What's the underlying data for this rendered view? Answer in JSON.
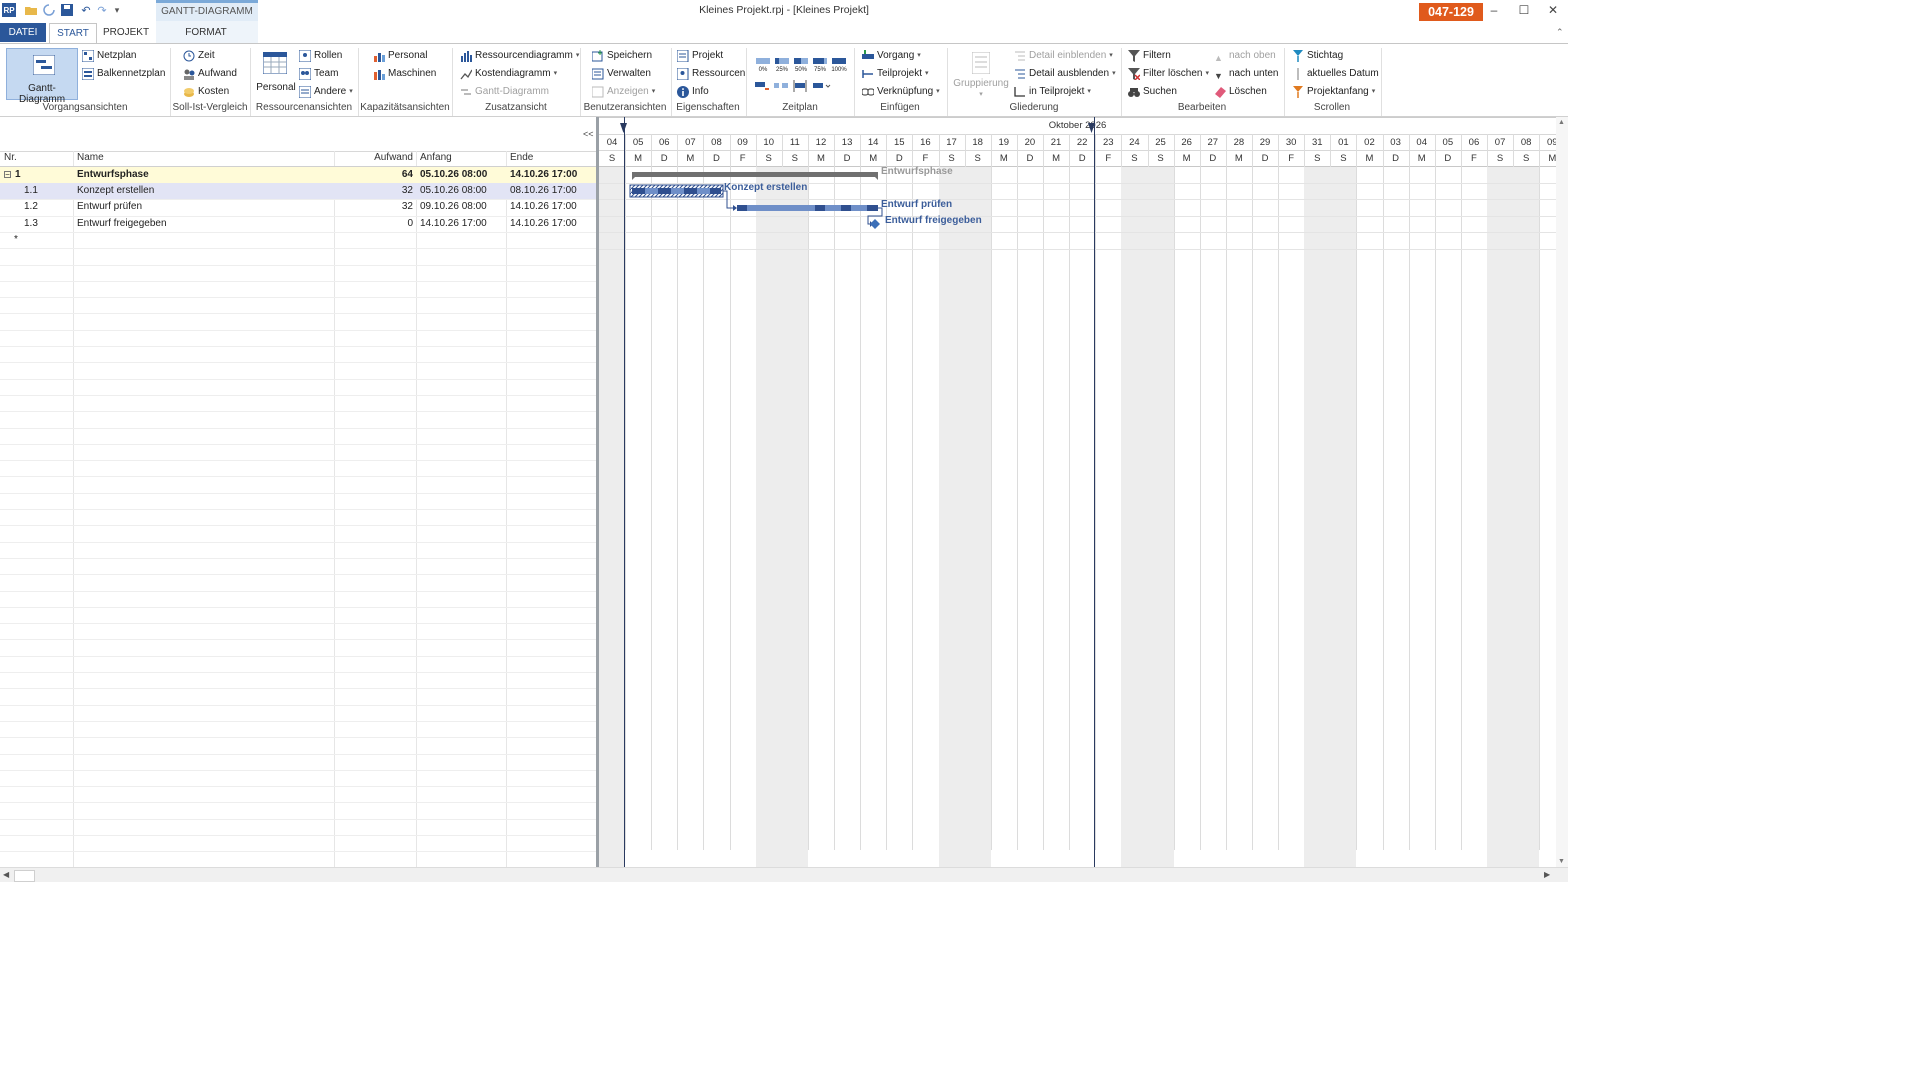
{
  "window": {
    "title": "Kleines Projekt.rpj - [Kleines Projekt]",
    "badge": "047-129",
    "min": "–",
    "max": "☐",
    "close": "✕"
  },
  "tabs": {
    "datei": "DATEI",
    "start": "START",
    "projekt": "PROJEKT",
    "context_group": "GANTT-DIAGRAMM",
    "format": "FORMAT"
  },
  "ribbon": {
    "vorgangsansichten": {
      "label": "Vorgangsansichten",
      "gantt": "Gantt-Diagramm",
      "netzplan": "Netzplan",
      "balkennetzplan": "Balkennetzplan"
    },
    "sollist": {
      "label": "Soll-Ist-Vergleich",
      "zeit": "Zeit",
      "aufwand": "Aufwand",
      "kosten": "Kosten"
    },
    "ressourcen": {
      "label": "Ressourcenansichten",
      "personal": "Personal",
      "rollen": "Rollen",
      "team": "Team",
      "andere": "Andere"
    },
    "kapazitaet": {
      "label": "Kapazitätsansichten",
      "personal": "Personal",
      "maschinen": "Maschinen"
    },
    "zusatz": {
      "label": "Zusatzansicht",
      "ressourcendiagramm": "Ressourcendiagramm",
      "kostendiagramm": "Kostendiagramm",
      "gantt": "Gantt-Diagramm"
    },
    "benutzer": {
      "label": "Benutzeransichten",
      "speichern": "Speichern",
      "verwalten": "Verwalten",
      "anzeigen": "Anzeigen"
    },
    "eigenschaften": {
      "label": "Eigenschaften",
      "projekt": "Projekt",
      "ressourcen": "Ressourcen",
      "info": "Info"
    },
    "zeitplan": {
      "label": "Zeitplan",
      "p0": "0%",
      "p25": "25%",
      "p50": "50%",
      "p75": "75%",
      "p100": "100%"
    },
    "einfuegen": {
      "label": "Einfügen",
      "vorgang": "Vorgang",
      "teilprojekt": "Teilprojekt",
      "verknuepfung": "Verknüpfung"
    },
    "gliederung": {
      "label": "Gliederung",
      "gruppierung": "Gruppierung",
      "detail_ein": "Detail einblenden",
      "detail_aus": "Detail ausblenden",
      "in_teilprojekt": "in Teilprojekt"
    },
    "bearbeiten": {
      "label": "Bearbeiten",
      "filtern": "Filtern",
      "filter_loeschen": "Filter löschen",
      "suchen": "Suchen",
      "nach_oben": "nach oben",
      "nach_unten": "nach unten",
      "loeschen": "Löschen"
    },
    "scrollen": {
      "label": "Scrollen",
      "stichtag": "Stichtag",
      "aktuelles_datum": "aktuelles Datum",
      "projektanfang": "Projektanfang"
    }
  },
  "grid": {
    "collapse": "<<",
    "headers": {
      "nr": "Nr.",
      "name": "Name",
      "aufwand": "Aufwand",
      "anfang": "Anfang",
      "ende": "Ende"
    },
    "rows": [
      {
        "nr": "1",
        "name": "Entwurfsphase",
        "aufwand": "64",
        "anfang": "05.10.26 08:00",
        "ende": "14.10.26 17:00"
      },
      {
        "nr": "1.1",
        "name": "Konzept erstellen",
        "aufwand": "32",
        "anfang": "05.10.26 08:00",
        "ende": "08.10.26 17:00"
      },
      {
        "nr": "1.2",
        "name": "Entwurf prüfen",
        "aufwand": "32",
        "anfang": "09.10.26 08:00",
        "ende": "14.10.26 17:00"
      },
      {
        "nr": "1.3",
        "name": "Entwurf freigegeben",
        "aufwand": "0",
        "anfang": "14.10.26 17:00",
        "ende": "14.10.26 17:00"
      }
    ],
    "new_row": "*"
  },
  "gantt": {
    "month": "Oktober 2026",
    "days": [
      "04",
      "05",
      "06",
      "07",
      "08",
      "09",
      "10",
      "11",
      "12",
      "13",
      "14",
      "15",
      "16",
      "17",
      "18",
      "19",
      "20",
      "21",
      "22",
      "23",
      "24",
      "25",
      "26",
      "27",
      "28",
      "29",
      "30",
      "31",
      "01",
      "02",
      "03",
      "04",
      "05",
      "06",
      "07",
      "08",
      "09"
    ],
    "weekdays": [
      "S",
      "M",
      "D",
      "M",
      "D",
      "F",
      "S",
      "S",
      "M",
      "D",
      "M",
      "D",
      "F",
      "S",
      "S",
      "M",
      "D",
      "M",
      "D",
      "F",
      "S",
      "S",
      "M",
      "D",
      "M",
      "D",
      "F",
      "S",
      "S",
      "M",
      "D",
      "M",
      "D",
      "F",
      "S",
      "S",
      "M"
    ],
    "bars": {
      "summary": "Entwurfsphase",
      "t1": "Konzept erstellen",
      "t2": "Entwurf prüfen",
      "t3": "Entwurf freigegeben"
    },
    "colors": {
      "bar": "#2f4f8f",
      "bar_light": "#6f8fc8",
      "summary": "#707070"
    }
  }
}
